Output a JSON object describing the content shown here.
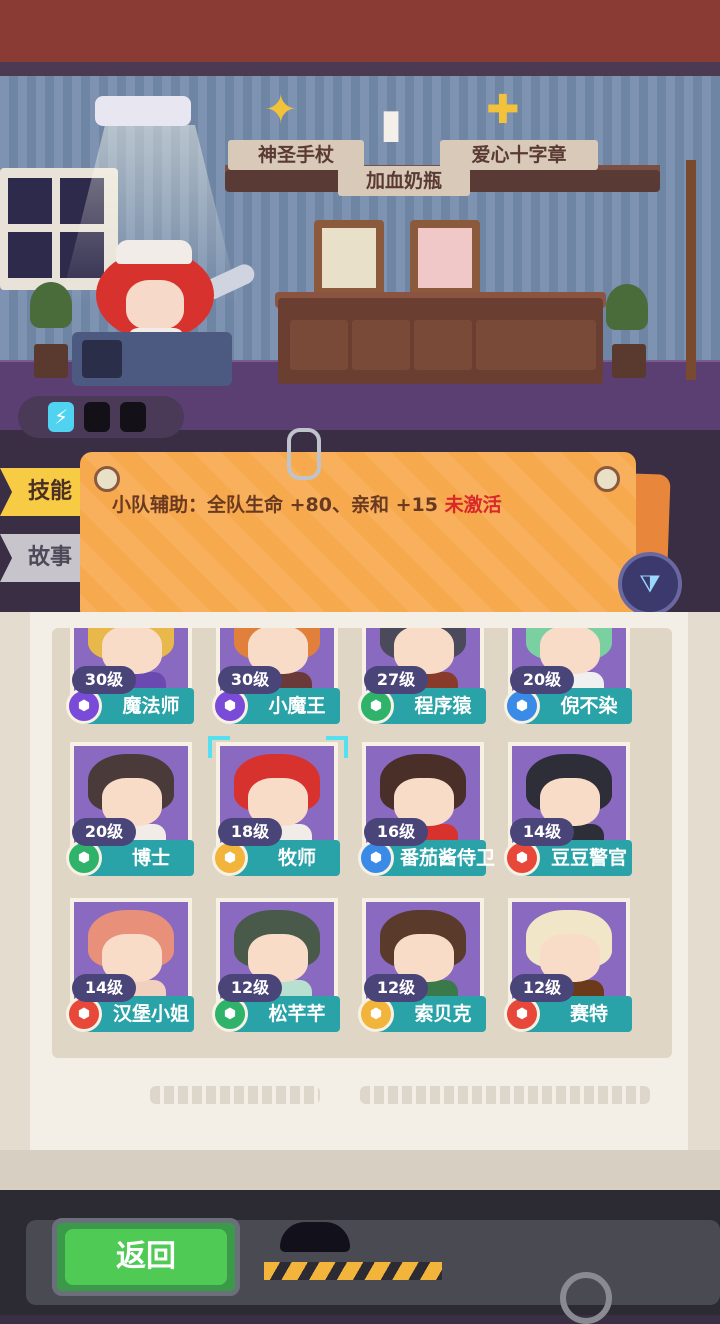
{
  "shelf_items": [
    {
      "label": "神圣手杖",
      "icon": "holy-staff-icon"
    },
    {
      "label": "加血奶瓶",
      "icon": "milk-bottle-icon"
    },
    {
      "label": "爱心十字章",
      "icon": "heart-cross-badge-icon"
    }
  ],
  "tabs": {
    "skill": "技能",
    "story": "故事"
  },
  "skill": {
    "description": "小队辅助：全队生命 +80、亲和 +15",
    "status": "未激活",
    "status_color": "#d8282a"
  },
  "characters": [
    {
      "name": "魔法师",
      "level": "30级",
      "badge": "purple",
      "portrait": "#8a6ac0",
      "hair": "#e9b84a",
      "outfit": "#6a4ab0"
    },
    {
      "name": "小魔王",
      "level": "30级",
      "badge": "purple",
      "portrait": "#8a6ac0",
      "hair": "#e0803a",
      "outfit": "#6a3a3a"
    },
    {
      "name": "程序猿",
      "level": "27级",
      "badge": "green",
      "portrait": "#8a6ac0",
      "hair": "#4a4a5a",
      "outfit": "#8a3a2a"
    },
    {
      "name": "倪不染",
      "level": "20级",
      "badge": "blue",
      "portrait": "#8a6ac0",
      "hair": "#7ad0a0",
      "outfit": "#f0f0f0"
    },
    {
      "name": "博士",
      "level": "20级",
      "badge": "green",
      "portrait": "#8a6ac0",
      "hair": "#4a3a3a",
      "outfit": "#f2ece8"
    },
    {
      "name": "牧师",
      "level": "18级",
      "badge": "gold",
      "portrait": "#8a6ac0",
      "hair": "#d8322e",
      "outfit": "#f2ece8"
    },
    {
      "name": "番茄酱侍卫",
      "level": "16级",
      "badge": "blue",
      "portrait": "#8a6ac0",
      "hair": "#4a2e28",
      "outfit": "#d8322e"
    },
    {
      "name": "豆豆警官",
      "level": "14级",
      "badge": "red",
      "portrait": "#8a6ac0",
      "hair": "#2e2e38",
      "outfit": "#2e2e38"
    },
    {
      "name": "汉堡小姐",
      "level": "14级",
      "badge": "red",
      "portrait": "#8a6ac0",
      "hair": "#e8907a",
      "outfit": "#f2d0c0"
    },
    {
      "name": "松芊芊",
      "level": "12级",
      "badge": "green",
      "portrait": "#8a6ac0",
      "hair": "#4a5a4a",
      "outfit": "#b8e0d0"
    },
    {
      "name": "索贝克",
      "level": "12级",
      "badge": "gold",
      "portrait": "#8a6ac0",
      "hair": "#5a3a2a",
      "outfit": "#3a7a4a"
    },
    {
      "name": "赛特",
      "level": "12级",
      "badge": "red",
      "portrait": "#8a6ac0",
      "hair": "#f2e6c8",
      "outfit": "#6a3a1a"
    }
  ],
  "badge_colors": {
    "purple": "#7a4ad8",
    "green": "#2fb36a",
    "blue": "#3a8ae8",
    "gold": "#f2b43a",
    "red": "#e8483a"
  },
  "back_button": "返回",
  "filter_icon": "filter-icon",
  "energy_icon": "lightning-icon"
}
